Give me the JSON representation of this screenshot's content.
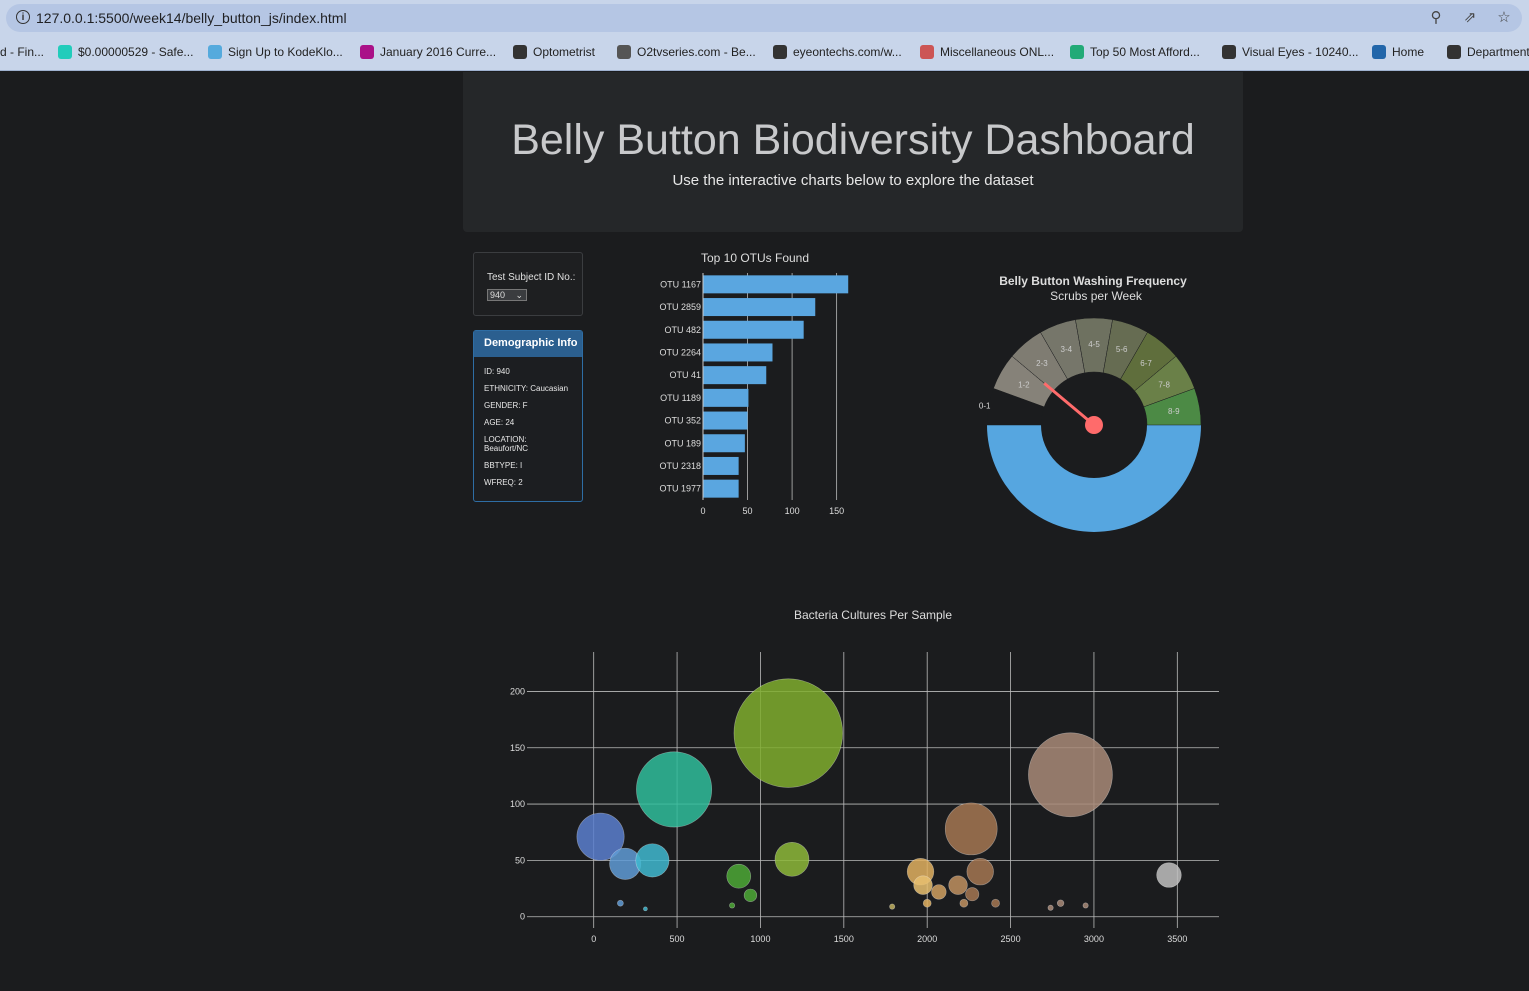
{
  "browser": {
    "url": "127.0.0.1:5500/week14/belly_button_js/index.html",
    "bookmarks": [
      {
        "label": "d - Fin...",
        "color": "#4a6"
      },
      {
        "label": "$0.00000529 - Safe...",
        "color": "#2cb"
      },
      {
        "label": "Sign Up to KodeKlo...",
        "color": "#5ad"
      },
      {
        "label": "January 2016 Curre...",
        "color": "#a18"
      },
      {
        "label": "Optometrist",
        "color": "#333"
      },
      {
        "label": "O2tvseries.com - Be...",
        "color": "#555"
      },
      {
        "label": "eyeontechs.com/w...",
        "color": "#333"
      },
      {
        "label": "Miscellaneous ONL...",
        "color": "#c55"
      },
      {
        "label": "Top 50 Most Afford...",
        "color": "#2a7"
      },
      {
        "label": "Visual Eyes - 10240...",
        "color": "#333"
      },
      {
        "label": "Home",
        "color": "#26a"
      },
      {
        "label": "Department",
        "color": "#333"
      }
    ]
  },
  "header": {
    "title": "Belly Button Biodiversity Dashboard",
    "subtitle": "Use the interactive charts below to explore the dataset"
  },
  "selector": {
    "label": "Test Subject ID No.:",
    "selected": "940"
  },
  "demographics": {
    "title": "Demographic Info",
    "rows": [
      "ID: 940",
      "ETHNICITY: Caucasian",
      "GENDER: F",
      "AGE: 24",
      "LOCATION: Beaufort/NC",
      "BBTYPE: I",
      "WFREQ: 2"
    ]
  },
  "colors": {
    "bar": "#5aa6e0",
    "needle": "#ff6b6b",
    "gauge_base": "#56a6e0"
  },
  "chart_data": [
    {
      "type": "bar",
      "orientation": "horizontal",
      "title": "Top 10 OTUs Found",
      "categories": [
        "OTU 1167",
        "OTU 2859",
        "OTU 482",
        "OTU 2264",
        "OTU 41",
        "OTU 1189",
        "OTU 352",
        "OTU 189",
        "OTU 2318",
        "OTU 1977"
      ],
      "values": [
        163,
        126,
        113,
        78,
        71,
        51,
        50,
        47,
        40,
        40
      ],
      "xticks": [
        "0",
        "50",
        "100",
        "150"
      ],
      "xlim": [
        0,
        165
      ]
    },
    {
      "type": "gauge",
      "title": "Belly Button Washing Frequency",
      "subtitle": "Scrubs per Week",
      "sections": [
        "0-1",
        "1-2",
        "2-3",
        "3-4",
        "4-5",
        "5-6",
        "6-7",
        "7-8",
        "8-9"
      ],
      "section_colors": [
        "#1b1c1e",
        "#868279",
        "#7f7c72",
        "#76766a",
        "#6e7160",
        "#666c52",
        "#5f6e3c",
        "#6a8048",
        "#4c8a45"
      ],
      "value": 2,
      "range": [
        0,
        9
      ]
    },
    {
      "type": "scatter",
      "title": "Bacteria Cultures Per Sample",
      "xticks": [
        "0",
        "500",
        "1000",
        "1500",
        "2000",
        "2500",
        "3000",
        "3500"
      ],
      "yticks": [
        "0",
        "50",
        "100",
        "150",
        "200"
      ],
      "xlim": [
        -400,
        3750
      ],
      "ylim": [
        -10,
        235
      ],
      "points": [
        {
          "x": 41,
          "y": 71,
          "size": 71,
          "color": "#5a7fcf"
        },
        {
          "x": 189,
          "y": 47,
          "size": 47,
          "color": "#5f9bd6"
        },
        {
          "x": 352,
          "y": 50,
          "size": 50,
          "color": "#3fb8d0"
        },
        {
          "x": 482,
          "y": 113,
          "size": 113,
          "color": "#2fbd9b"
        },
        {
          "x": 870,
          "y": 36,
          "size": 36,
          "color": "#4ca836"
        },
        {
          "x": 940,
          "y": 19,
          "size": 19,
          "color": "#4ca836"
        },
        {
          "x": 830,
          "y": 10,
          "size": 8,
          "color": "#4ca836"
        },
        {
          "x": 1167,
          "y": 163,
          "size": 163,
          "color": "#7fad2e"
        },
        {
          "x": 1189,
          "y": 51,
          "size": 51,
          "color": "#8db83a"
        },
        {
          "x": 1960,
          "y": 40,
          "size": 40,
          "color": "#e0b060"
        },
        {
          "x": 1975,
          "y": 28,
          "size": 28,
          "color": "#e8c070"
        },
        {
          "x": 2000,
          "y": 12,
          "size": 12,
          "color": "#e0b060"
        },
        {
          "x": 2070,
          "y": 22,
          "size": 22,
          "color": "#d0a060"
        },
        {
          "x": 2185,
          "y": 28,
          "size": 28,
          "color": "#c09060"
        },
        {
          "x": 2220,
          "y": 12,
          "size": 12,
          "color": "#c09060"
        },
        {
          "x": 2264,
          "y": 78,
          "size": 78,
          "color": "#a47752"
        },
        {
          "x": 2318,
          "y": 40,
          "size": 40,
          "color": "#a47752"
        },
        {
          "x": 2270,
          "y": 20,
          "size": 20,
          "color": "#a47752"
        },
        {
          "x": 2410,
          "y": 12,
          "size": 12,
          "color": "#a47752"
        },
        {
          "x": 2859,
          "y": 126,
          "size": 126,
          "color": "#a88a78"
        },
        {
          "x": 2800,
          "y": 12,
          "size": 10,
          "color": "#a88a78"
        },
        {
          "x": 2950,
          "y": 10,
          "size": 8,
          "color": "#a88a78"
        },
        {
          "x": 3450,
          "y": 37,
          "size": 37,
          "color": "#c0c0c0"
        },
        {
          "x": 160,
          "y": 12,
          "size": 9,
          "color": "#5f9bd6"
        },
        {
          "x": 310,
          "y": 7,
          "size": 6,
          "color": "#3fb8d0"
        },
        {
          "x": 1790,
          "y": 9,
          "size": 8,
          "color": "#c0b060"
        },
        {
          "x": 2740,
          "y": 8,
          "size": 8,
          "color": "#a88a78"
        }
      ]
    }
  ]
}
